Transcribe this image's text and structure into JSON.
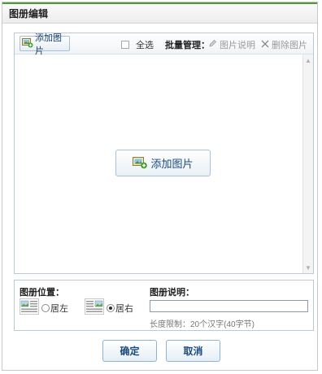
{
  "dialog": {
    "title": "图册编辑"
  },
  "toolbar": {
    "add_label": "添加图片",
    "select_all": "全选",
    "batch_label": "批量管理：",
    "caption_label": "图片说明",
    "delete_label": "删除图片"
  },
  "upload_area": {
    "add_button_label": "添加图片"
  },
  "properties": {
    "position_label": "图册位置：",
    "align_left_label": "居左",
    "align_right_label": "居右",
    "selected_alignment": "right",
    "description_label": "图册说明：",
    "description_value": "",
    "length_limit": "长度限制：20个汉字(40字节)"
  },
  "footer": {
    "confirm_label": "确定",
    "cancel_label": "取消"
  },
  "icons": {
    "add_image": "add-image-icon",
    "caption": "pencil-icon",
    "delete": "x-icon",
    "align_left": "align-left-layout-icon",
    "align_right": "align-right-layout-icon",
    "scroll_up": "arrow-up-icon",
    "scroll_down": "arrow-down-icon"
  },
  "colors": {
    "title_accent": "#4e9a35",
    "panel_border": "#b9c9d6",
    "button_text": "#1b4a7c"
  }
}
